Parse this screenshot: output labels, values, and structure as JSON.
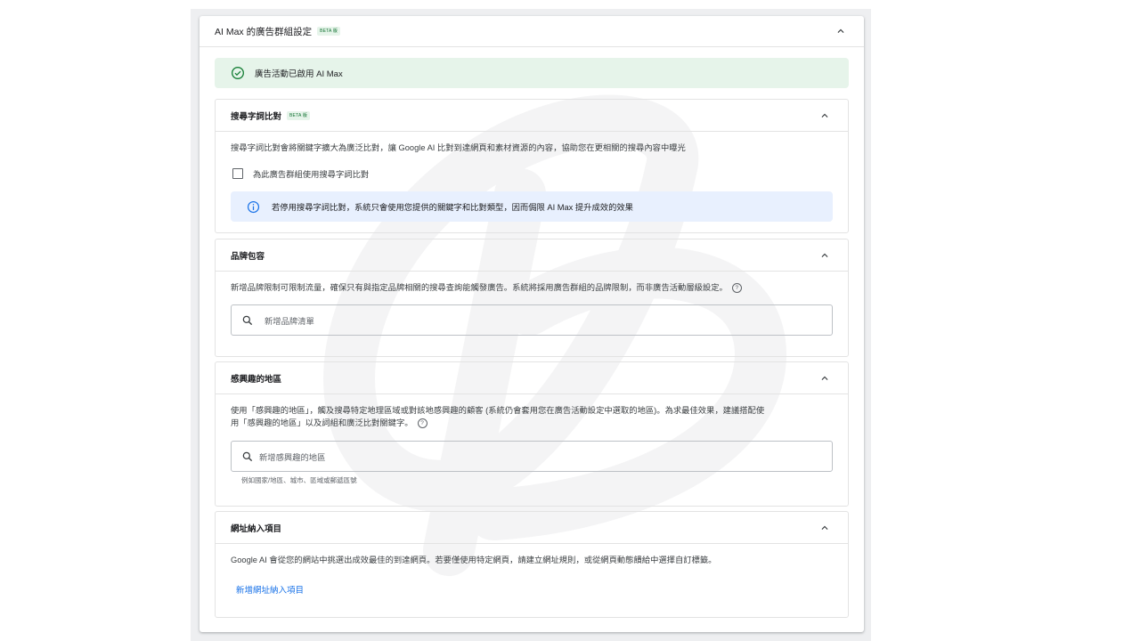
{
  "header": {
    "title": "AI Max 的廣告群組設定",
    "beta": "BETA 版"
  },
  "status": {
    "text": "廣告活動已啟用 AI Max"
  },
  "search_term_matching": {
    "title": "搜尋字詞比對",
    "beta": "BETA 版",
    "description": "搜尋字詞比對會將關鍵字擴大為廣泛比對，讓 Google AI 比對到達網頁和素材資源的內容，協助您在更相關的搜尋內容中曝光",
    "checkbox_label": "為此廣告群組使用搜尋字詞比對",
    "checkbox_checked": false,
    "info_text": "若停用搜尋字詞比對，系統只會使用您提供的關鍵字和比對類型，因而侷限 AI Max 提升成效的效果"
  },
  "brand_inclusions": {
    "title": "品牌包容",
    "description": "新增品牌限制可限制流量，確保只有與指定品牌相關的搜尋查詢能觸發廣告。系統將採用廣告群組的品牌限制，而非廣告活動層級設定。",
    "search_placeholder": "新增品牌清單"
  },
  "locations_of_interest": {
    "title": "感興趣的地區",
    "description_line1": "使用「感興趣的地區」，觸及搜尋特定地理區域或對該地感興趣的顧客 (系統仍會套用您在廣告活動設定中選取的地區)。為求最佳效果，建議搭配使",
    "description_line2": "用「感興趣的地區」以及詞組和廣泛比對關鍵字。",
    "search_placeholder": "新增感興趣的地區",
    "hint": "例如國家/地區、城市、區域或郵遞區號"
  },
  "url_inclusions": {
    "title": "網址納入項目",
    "description": "Google AI 會從您的網站中挑選出成效最佳的到達網頁。若要僅使用特定網頁，請建立網址規則，或從網頁動態饋給中選擇自訂標籤。",
    "link": "新增網址納入項目"
  },
  "icons": {
    "status": "check-circle-icon",
    "info": "info-icon",
    "search": "search-icon",
    "help": "help-icon",
    "collapse": "chevron-up-icon"
  },
  "colors": {
    "success_bg": "#e6f4ea",
    "success": "#188038",
    "info_bg": "#e8f0fe",
    "info": "#1a73e8",
    "link": "#1a73e8"
  }
}
